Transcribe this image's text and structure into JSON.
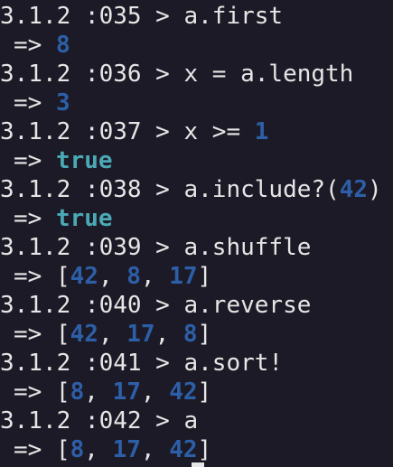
{
  "colors": {
    "background": "#1c1a26",
    "text": "#e6e6e6",
    "number": "#2d5fa8",
    "boolean": "#4aa9b5"
  },
  "lines": [
    {
      "kind": "prompt",
      "tokens": [
        {
          "t": "3.1.2 :035 > a.first",
          "c": "plain"
        }
      ]
    },
    {
      "kind": "result",
      "tokens": [
        {
          "t": "=> ",
          "c": "plain"
        },
        {
          "t": "8",
          "c": "num"
        }
      ]
    },
    {
      "kind": "prompt",
      "tokens": [
        {
          "t": "3.1.2 :036 > x = a.length",
          "c": "plain"
        }
      ]
    },
    {
      "kind": "result",
      "tokens": [
        {
          "t": "=> ",
          "c": "plain"
        },
        {
          "t": "3",
          "c": "num"
        }
      ]
    },
    {
      "kind": "prompt",
      "tokens": [
        {
          "t": "3.1.2 :037 > x >= ",
          "c": "plain"
        },
        {
          "t": "1",
          "c": "num"
        }
      ]
    },
    {
      "kind": "result",
      "tokens": [
        {
          "t": "=> ",
          "c": "plain"
        },
        {
          "t": "true",
          "c": "bool"
        }
      ]
    },
    {
      "kind": "prompt",
      "tokens": [
        {
          "t": "3.1.2 :038 > a.include?(",
          "c": "plain"
        },
        {
          "t": "42",
          "c": "num"
        },
        {
          "t": ")",
          "c": "plain"
        }
      ]
    },
    {
      "kind": "result",
      "tokens": [
        {
          "t": "=> ",
          "c": "plain"
        },
        {
          "t": "true",
          "c": "bool"
        }
      ]
    },
    {
      "kind": "prompt",
      "tokens": [
        {
          "t": "3.1.2 :039 > a.shuffle",
          "c": "plain"
        }
      ]
    },
    {
      "kind": "result",
      "tokens": [
        {
          "t": "=> [",
          "c": "plain"
        },
        {
          "t": "42",
          "c": "num"
        },
        {
          "t": ", ",
          "c": "plain"
        },
        {
          "t": "8",
          "c": "num"
        },
        {
          "t": ", ",
          "c": "plain"
        },
        {
          "t": "17",
          "c": "num"
        },
        {
          "t": "]",
          "c": "plain"
        }
      ]
    },
    {
      "kind": "prompt",
      "tokens": [
        {
          "t": "3.1.2 :040 > a.reverse",
          "c": "plain"
        }
      ]
    },
    {
      "kind": "result",
      "tokens": [
        {
          "t": "=> [",
          "c": "plain"
        },
        {
          "t": "42",
          "c": "num"
        },
        {
          "t": ", ",
          "c": "plain"
        },
        {
          "t": "17",
          "c": "num"
        },
        {
          "t": ", ",
          "c": "plain"
        },
        {
          "t": "8",
          "c": "num"
        },
        {
          "t": "]",
          "c": "plain"
        }
      ]
    },
    {
      "kind": "prompt",
      "tokens": [
        {
          "t": "3.1.2 :041 > a.sort!",
          "c": "plain"
        }
      ]
    },
    {
      "kind": "result",
      "tokens": [
        {
          "t": "=> [",
          "c": "plain"
        },
        {
          "t": "8",
          "c": "num"
        },
        {
          "t": ", ",
          "c": "plain"
        },
        {
          "t": "17",
          "c": "num"
        },
        {
          "t": ", ",
          "c": "plain"
        },
        {
          "t": "42",
          "c": "num"
        },
        {
          "t": "]",
          "c": "plain"
        }
      ]
    },
    {
      "kind": "prompt",
      "tokens": [
        {
          "t": "3.1.2 :042 > a",
          "c": "plain"
        }
      ]
    },
    {
      "kind": "result",
      "tokens": [
        {
          "t": "=> [",
          "c": "plain"
        },
        {
          "t": "8",
          "c": "num"
        },
        {
          "t": ", ",
          "c": "plain"
        },
        {
          "t": "17",
          "c": "num"
        },
        {
          "t": ", ",
          "c": "plain"
        },
        {
          "t": "42",
          "c": "num"
        },
        {
          "t": "]",
          "c": "plain"
        }
      ]
    }
  ]
}
